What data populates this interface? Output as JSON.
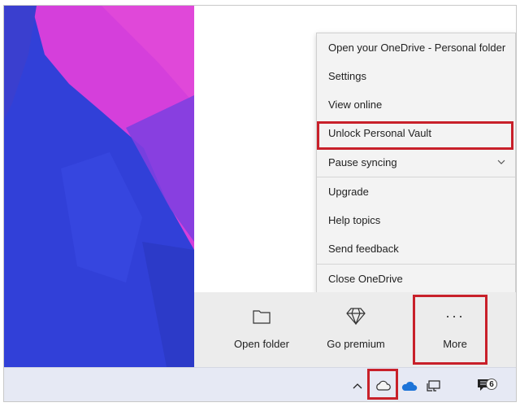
{
  "menu": {
    "items": [
      {
        "label": "Open your OneDrive - Personal folder"
      },
      {
        "label": "Settings"
      },
      {
        "label": "View online"
      },
      {
        "label": "Unlock Personal Vault"
      },
      {
        "label": "Pause syncing"
      },
      {
        "label": "Upgrade"
      },
      {
        "label": "Help topics"
      },
      {
        "label": "Send feedback"
      },
      {
        "label": "Close OneDrive"
      }
    ]
  },
  "actions": {
    "open_folder": "Open folder",
    "go_premium": "Go premium",
    "more": "More",
    "more_glyph": "···"
  },
  "taskbar": {
    "notification_count": "6",
    "icons": [
      "chevron-up-icon",
      "onedrive-cloud-outline-icon",
      "onedrive-blue-cloud-icon",
      "network-icon",
      "notification-icon"
    ]
  },
  "colors": {
    "highlight": "#c8202a",
    "menu_bg": "#f3f3f3",
    "action_bar_bg": "#ececec",
    "taskbar_bg": "#e6e9f4",
    "wallpaper_blue": "#2f3fd6",
    "wallpaper_magenta": "#d23fd8"
  }
}
